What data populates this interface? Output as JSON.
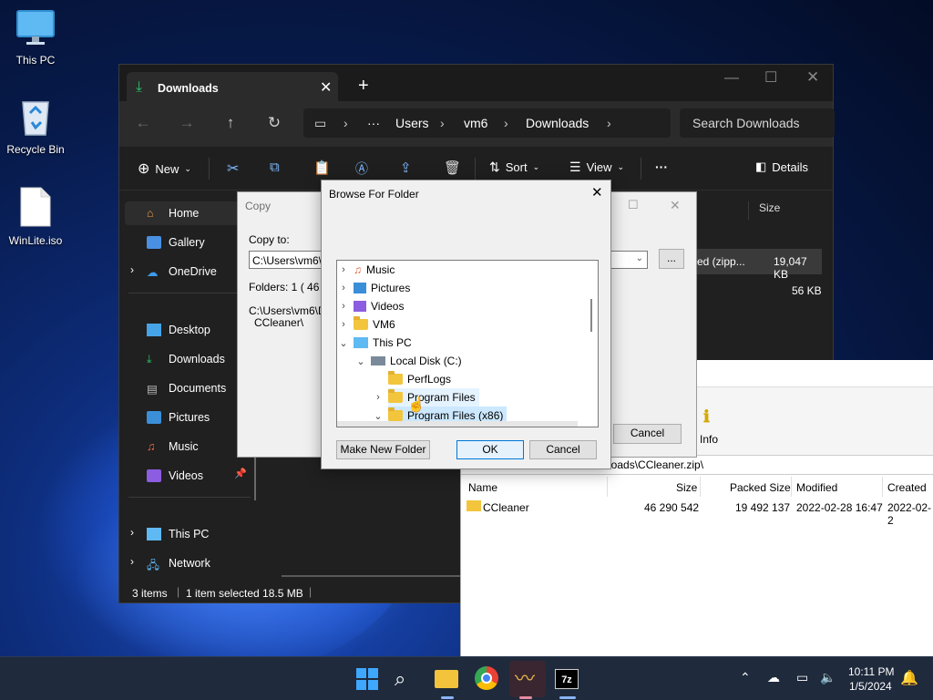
{
  "desktop": {
    "icons": [
      {
        "label": "This PC"
      },
      {
        "label": "Recycle Bin"
      },
      {
        "label": "WinLite.iso"
      }
    ]
  },
  "explorer": {
    "tab_title": "Downloads",
    "breadcrumb": [
      "Users",
      "vm6",
      "Downloads"
    ],
    "breadcrumb_more": "···",
    "search_placeholder": "Search Downloads",
    "commands": {
      "new": "New",
      "sort": "Sort",
      "view": "View",
      "more": "···",
      "details": "Details"
    },
    "nav": [
      {
        "label": "Home"
      },
      {
        "label": "Gallery"
      },
      {
        "label": "OneDrive"
      },
      {
        "label": "Desktop"
      },
      {
        "label": "Downloads"
      },
      {
        "label": "Documents"
      },
      {
        "label": "Pictures"
      },
      {
        "label": "Music"
      },
      {
        "label": "Videos"
      },
      {
        "label": "This PC"
      },
      {
        "label": "Network"
      }
    ],
    "column_size": "Size",
    "files": [
      {
        "type": "ed (zipp...",
        "size": "19,047 KB"
      },
      {
        "type": "",
        "size": "56 KB"
      }
    ],
    "status": {
      "count": "3 items",
      "selected": "1 item selected  18.5 MB"
    }
  },
  "copy_dialog": {
    "title": "Copy",
    "copy_to_label": "Copy to:",
    "path_value": "C:\\Users\\vm6\\D",
    "browse_button": "...",
    "folders_line": "Folders: 1    ( 46 2",
    "source_line1": "C:\\Users\\vm6\\D",
    "source_line2": "CCleaner\\",
    "cancel": "Cancel"
  },
  "sevenzip": {
    "info_label": "Info",
    "path": "loads\\CCleaner.zip\\",
    "columns": [
      "Name",
      "Size",
      "Packed Size",
      "Modified",
      "Created"
    ],
    "rows": [
      {
        "name": "CCleaner",
        "size": "46 290 542",
        "packed": "19 492 137",
        "modified": "2022-02-28 16:47",
        "created": "2022-02-2"
      }
    ]
  },
  "browse_dialog": {
    "title": "Browse For Folder",
    "tree": [
      {
        "label": "Music"
      },
      {
        "label": "Pictures"
      },
      {
        "label": "Videos"
      },
      {
        "label": "VM6"
      },
      {
        "label": "This PC"
      },
      {
        "label": "Local Disk (C:)"
      },
      {
        "label": "PerfLogs"
      },
      {
        "label": "Program Files"
      },
      {
        "label": "Program Files (x86)"
      }
    ],
    "make_new_folder": "Make New Folder",
    "ok": "OK",
    "cancel": "Cancel"
  },
  "taskbar": {
    "time": "10:11 PM",
    "date": "1/5/2024"
  }
}
